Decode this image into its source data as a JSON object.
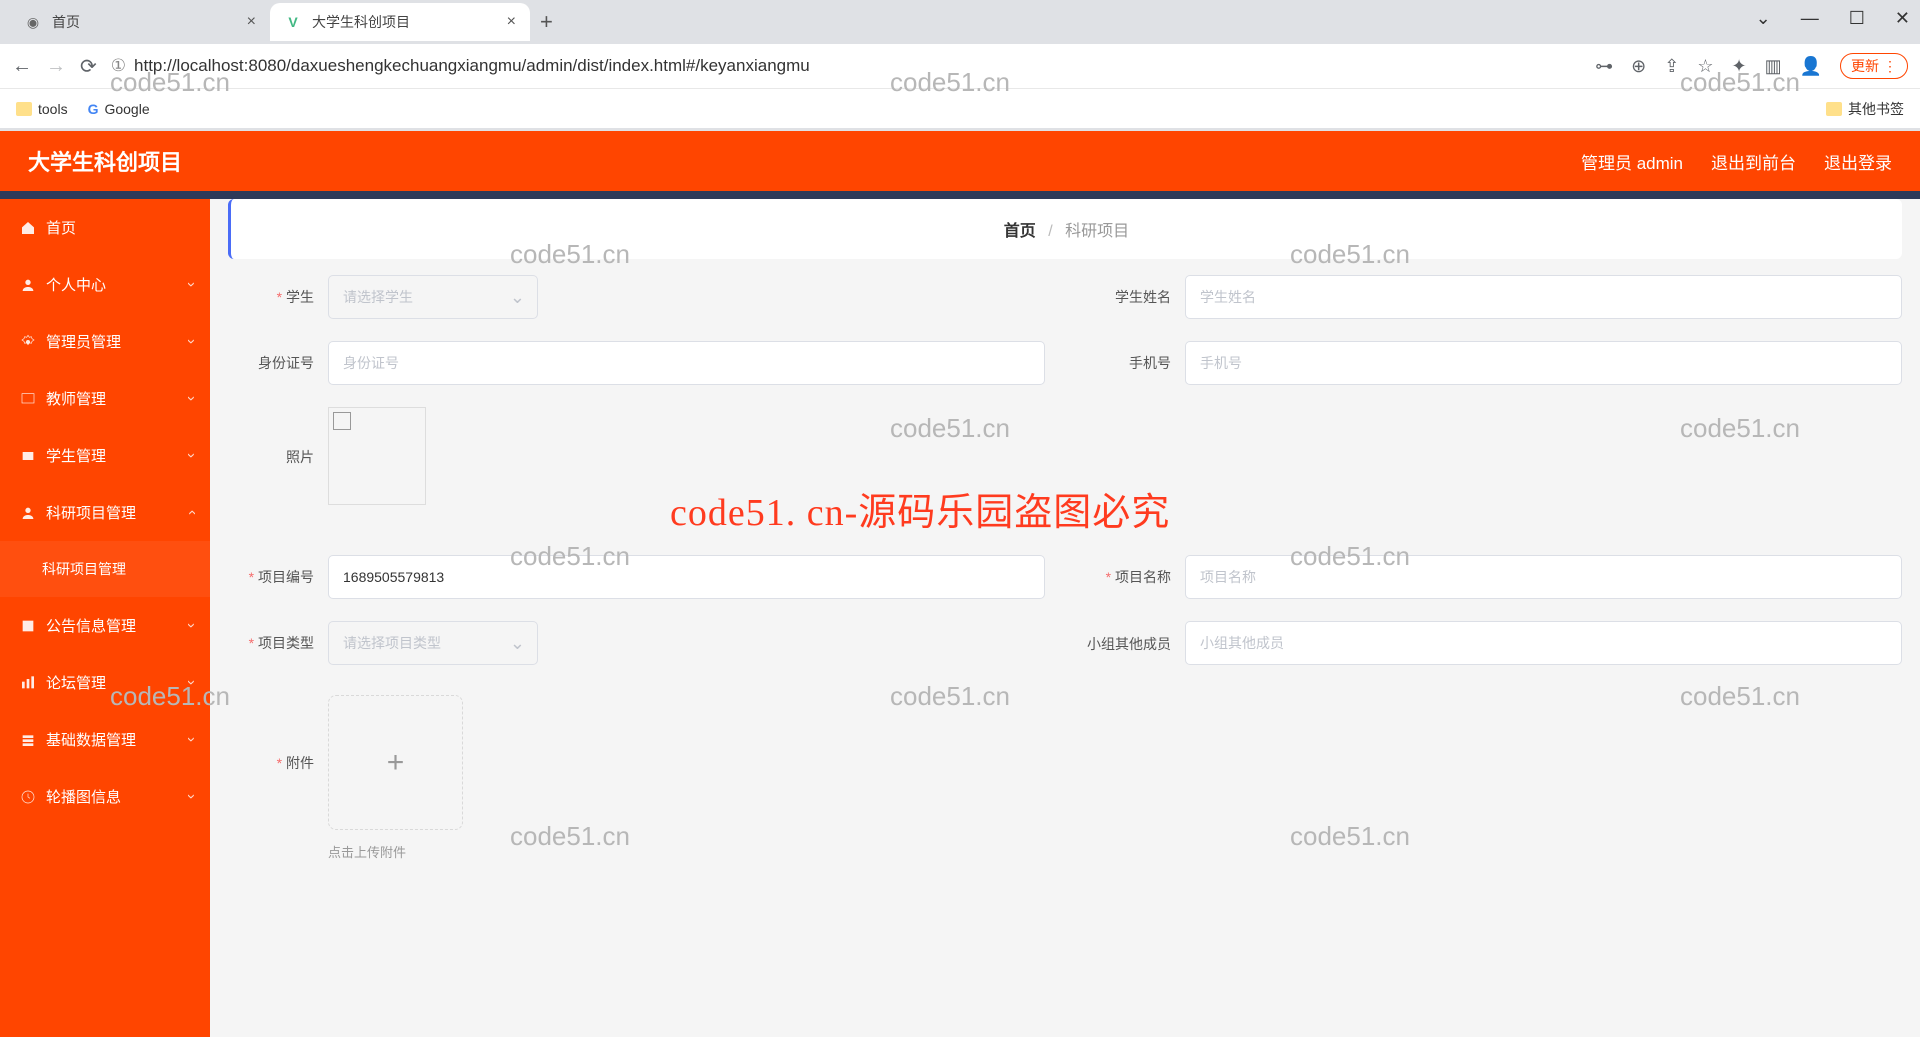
{
  "browser": {
    "tabs": [
      {
        "title": "首页"
      },
      {
        "title": "大学生科创项目"
      }
    ],
    "url_prefix": "①",
    "url": "http://localhost:8080/daxueshengkechuangxiangmu/admin/dist/index.html#/keyanxiangmu",
    "update_btn": "更新",
    "bookmarks": {
      "tools": "tools",
      "google": "Google",
      "other": "其他书签"
    },
    "win": {
      "min": "—",
      "max": "☐",
      "close": "✕",
      "chev": "⌄"
    }
  },
  "header": {
    "title": "大学生科创项目",
    "admin": "管理员 admin",
    "front": "退出到前台",
    "logout": "退出登录"
  },
  "sidebar": {
    "items": [
      {
        "label": "首页"
      },
      {
        "label": "个人中心"
      },
      {
        "label": "管理员管理"
      },
      {
        "label": "教师管理"
      },
      {
        "label": "学生管理"
      },
      {
        "label": "科研项目管理"
      },
      {
        "label": "科研项目管理"
      },
      {
        "label": "公告信息管理"
      },
      {
        "label": "论坛管理"
      },
      {
        "label": "基础数据管理"
      },
      {
        "label": "轮播图信息"
      }
    ]
  },
  "breadcrumb": {
    "home": "首页",
    "sep": "/",
    "current": "科研项目"
  },
  "form": {
    "student": {
      "label": "学生",
      "placeholder": "请选择学生"
    },
    "student_name": {
      "label": "学生姓名",
      "placeholder": "学生姓名"
    },
    "id_no": {
      "label": "身份证号",
      "placeholder": "身份证号"
    },
    "phone": {
      "label": "手机号",
      "placeholder": "手机号"
    },
    "photo": {
      "label": "照片"
    },
    "proj_no": {
      "label": "项目编号",
      "value": "1689505579813"
    },
    "proj_name": {
      "label": "项目名称",
      "placeholder": "项目名称"
    },
    "proj_type": {
      "label": "项目类型",
      "placeholder": "请选择项目类型"
    },
    "team_other": {
      "label": "小组其他成员",
      "placeholder": "小组其他成员"
    },
    "attach": {
      "label": "附件",
      "hint": "点击上传附件",
      "plus": "+"
    }
  },
  "watermark": {
    "small": "code51.cn",
    "big": "code51. cn-源码乐园盗图必究"
  }
}
